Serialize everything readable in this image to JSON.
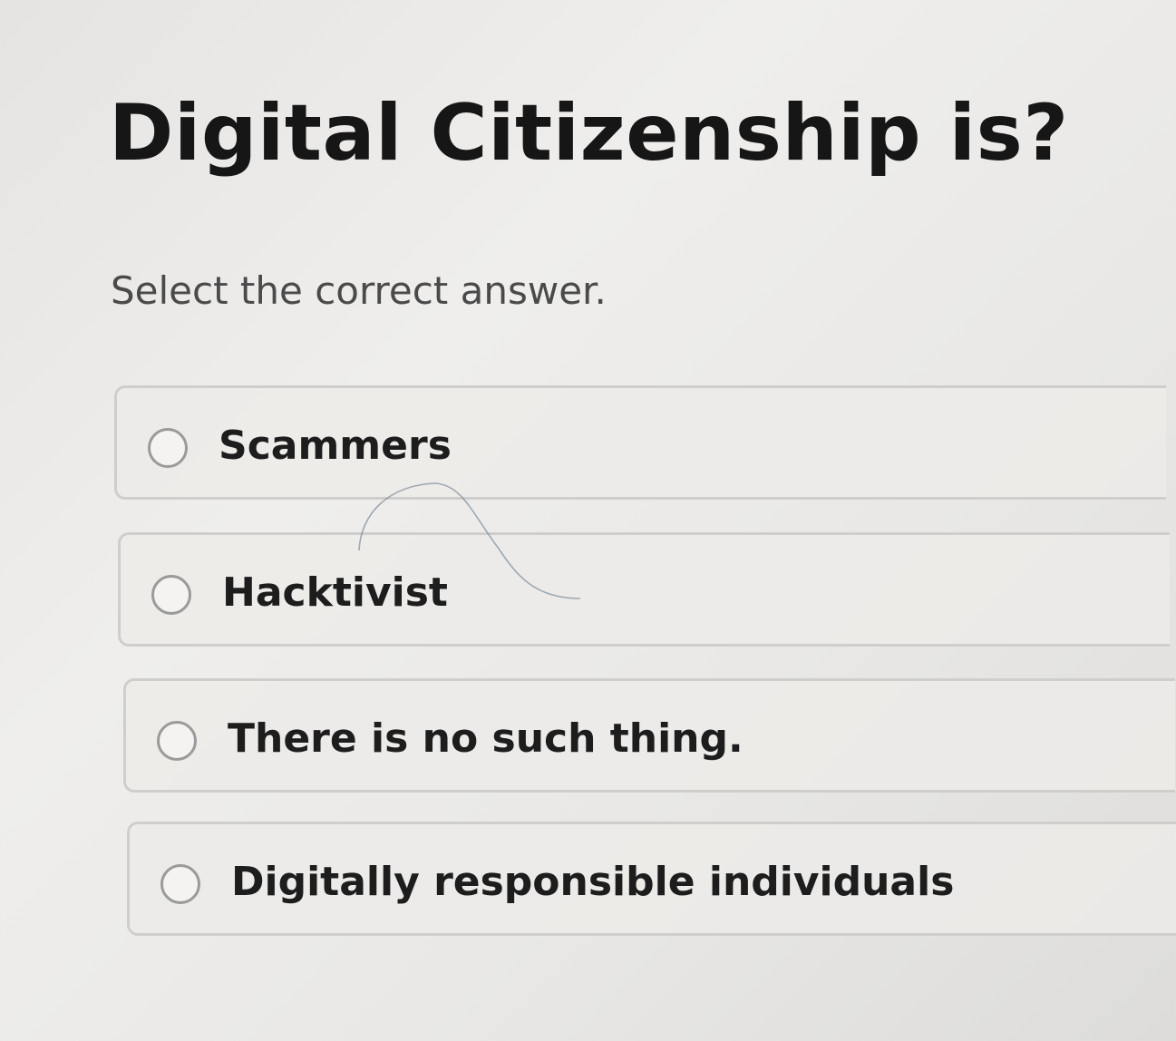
{
  "question": {
    "title": "Digital Citizenship is?",
    "instruction": "Select the correct answer."
  },
  "options": [
    {
      "label": "Scammers",
      "selected": false
    },
    {
      "label": "Hacktivist",
      "selected": false
    },
    {
      "label": "There is no such thing.",
      "selected": false
    },
    {
      "label": "Digitally responsible individuals",
      "selected": false
    }
  ]
}
